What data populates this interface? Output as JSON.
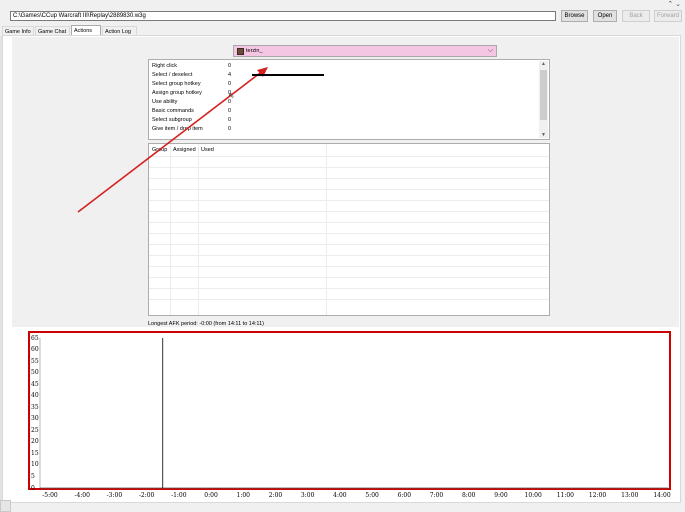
{
  "window": {
    "title_controls": "⌃ ⌄",
    "path": "C:\\Games\\CCup Warcraft III\\Replay\\2889830.w3g"
  },
  "toolbar": {
    "browse": "Browse",
    "open": "Open",
    "back": "Back",
    "forward": "Forward"
  },
  "tabs": [
    {
      "label": "Game Info"
    },
    {
      "label": "Game Chat"
    },
    {
      "label": "Actions"
    },
    {
      "label": "Action Log"
    }
  ],
  "player": {
    "name": "terzin_",
    "highlight_color": "#f5c6e4"
  },
  "actions": [
    {
      "name": "Right click",
      "value": "0"
    },
    {
      "name": "Select / deselect",
      "value": "4"
    },
    {
      "name": "Select group hotkey",
      "value": "0"
    },
    {
      "name": "Assign group hotkey",
      "value": "0"
    },
    {
      "name": "Use ability",
      "value": "0"
    },
    {
      "name": "Basic commands",
      "value": "0"
    },
    {
      "name": "Select subgroup",
      "value": "0"
    },
    {
      "name": "Give item / drop item",
      "value": "0"
    }
  ],
  "groups_table": {
    "columns": [
      "Group",
      "Assigned",
      "Used"
    ]
  },
  "afk_text": "Longest AFK period: -0:00 (from 14:11 to 14:11)",
  "chart_data": {
    "type": "line",
    "x_ticks": [
      "-5:00",
      "-4:00",
      "-3:00",
      "-2:00",
      "-1:00",
      "0:00",
      "1:00",
      "2:00",
      "3:00",
      "4:00",
      "5:00",
      "6:00",
      "7:00",
      "8:00",
      "9:00",
      "10:00",
      "11:00",
      "12:00",
      "13:00",
      "14:00"
    ],
    "y_ticks": [
      "65",
      "60",
      "55",
      "50",
      "45",
      "40",
      "35",
      "30",
      "25",
      "20",
      "15",
      "10",
      "5",
      "0"
    ],
    "ylim": [
      0,
      65
    ],
    "marker_x": "-1:30",
    "frame_color": "#cc0000"
  },
  "annotations": {
    "arrow_color": "#d32020"
  }
}
